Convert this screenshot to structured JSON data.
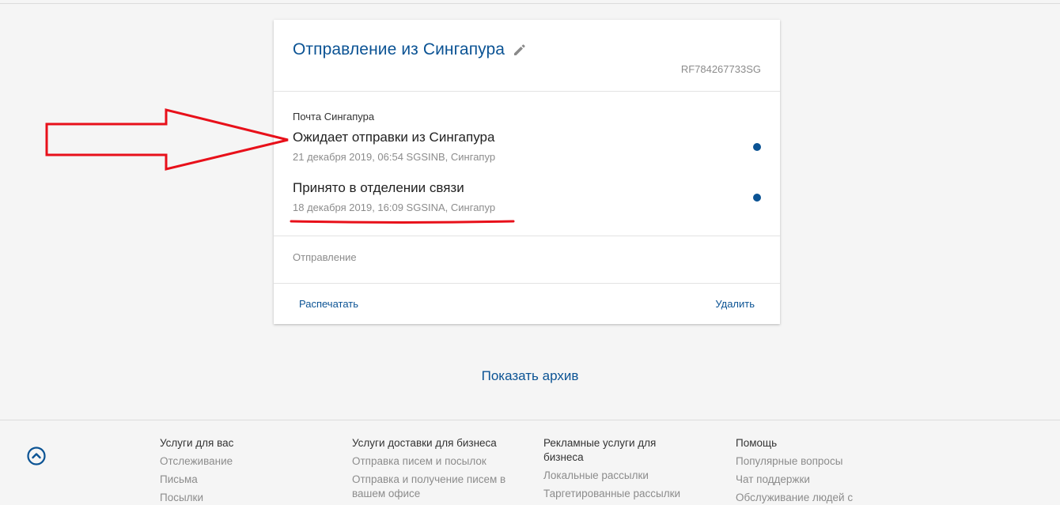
{
  "card": {
    "title": "Отправление из Сингапура",
    "tracking_number": "RF784267733SG",
    "carrier": "Почта Сингапура",
    "events": [
      {
        "status": "Ожидает отправки из Сингапура",
        "details": "21 декабря 2019, 06:54 SGSINB, Сингапур"
      },
      {
        "status": "Принято в отделении связи",
        "details": "18 декабря 2019, 16:09 SGSINA, Сингапур"
      }
    ],
    "section_label": "Отправление",
    "print_label": "Распечатать",
    "delete_label": "Удалить"
  },
  "archive_label": "Показать архив",
  "footer": {
    "columns": [
      {
        "heading": "Услуги для вас",
        "links": [
          "Отслеживание",
          "Письма",
          "Посылки"
        ]
      },
      {
        "heading": "Услуги доставки для бизнеса",
        "links": [
          "Отправка писем и посылок",
          "Отправка и получение писем в вашем офисе"
        ]
      },
      {
        "heading": "Рекламные услуги для бизнеса",
        "links": [
          "Локальные рассылки",
          "Таргетированные рассылки"
        ]
      },
      {
        "heading": "Помощь",
        "links": [
          "Популярные вопросы",
          "Чат поддержки",
          "Обслуживание людей с"
        ]
      }
    ]
  },
  "colors": {
    "accent": "#0b5394",
    "annotation_red": "#e8101a",
    "muted_text": "#8c8c8c",
    "background": "#f5f5f5"
  },
  "icons": {
    "edit": "pencil-icon",
    "scroll_top": "chevron-up-circle-icon"
  }
}
